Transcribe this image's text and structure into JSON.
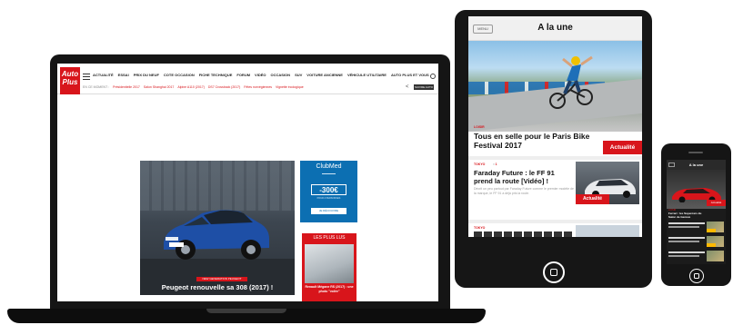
{
  "laptop": {
    "logo_line1": "Auto",
    "logo_line2": "Plus",
    "nav": [
      "ACTUALITÉ",
      "ESSAI",
      "PRIX DU NEUF",
      "COTE OCCASION",
      "FICHE TECHNIQUE",
      "FORUM",
      "VIDÉO",
      "OCCASION",
      "SUV",
      "VOITURE ANCIENNE",
      "VÉHICULE UTILITAIRE",
      "AUTO PLUS ET VOUS"
    ],
    "subbar_tag": "EN CE MOMENT :",
    "subbar_links": [
      "Présidentielle 2017",
      "Salon Shanghai 2017",
      "Alpine A110 (2017)",
      "DS7 Crossback (2017)",
      "Fêtes norvégiennes",
      "Vignette écologique"
    ],
    "follow_label": "SUIVRE AUTO PLUS",
    "hero": {
      "tag": "NEW GENERATION PEUGEOT",
      "caption": "Peugeot renouvelle sa 308 (2017) !",
      "plate": "FG 308 AA"
    },
    "ad": {
      "brand": "ClubMed",
      "price": "-300€",
      "small": "POUR 2 PERSONNES",
      "cta": "JE DÉCOUVRE"
    },
    "most_read": {
      "label": "LES PLUS LUS",
      "caption": "Renault Mégane RS (2017) : une photo \"volée\""
    }
  },
  "tablet": {
    "menu_label": "MENU",
    "title": "A la une",
    "lead": {
      "kicker": "LOISIR",
      "headline": "Tous en selle pour le Paris Bike Festival 2017",
      "badge": "Actualité"
    },
    "article2": {
      "kicker": "TOKYO",
      "comments": "1",
      "headline": "Faraday Future : le FF 91 prend la route [Vidéo] !",
      "excerpt": "Décrit un peu partout par Faraday Future comme le premier modèle de la marque, le FF 91 a déjà pris la route.",
      "badge": "Actualité"
    },
    "article3": {
      "kicker": "TOKYO"
    }
  },
  "phone": {
    "title": "A la une",
    "badge": "Actualité",
    "kicker": "LOISIR",
    "headline": "Ferrari : les Supercars du Salon de Genève"
  },
  "colors": {
    "brand_red": "#d8151b",
    "ad_blue": "#0c6fb2",
    "peugeot_blue": "#1e4fa6",
    "device_black": "#151515"
  }
}
